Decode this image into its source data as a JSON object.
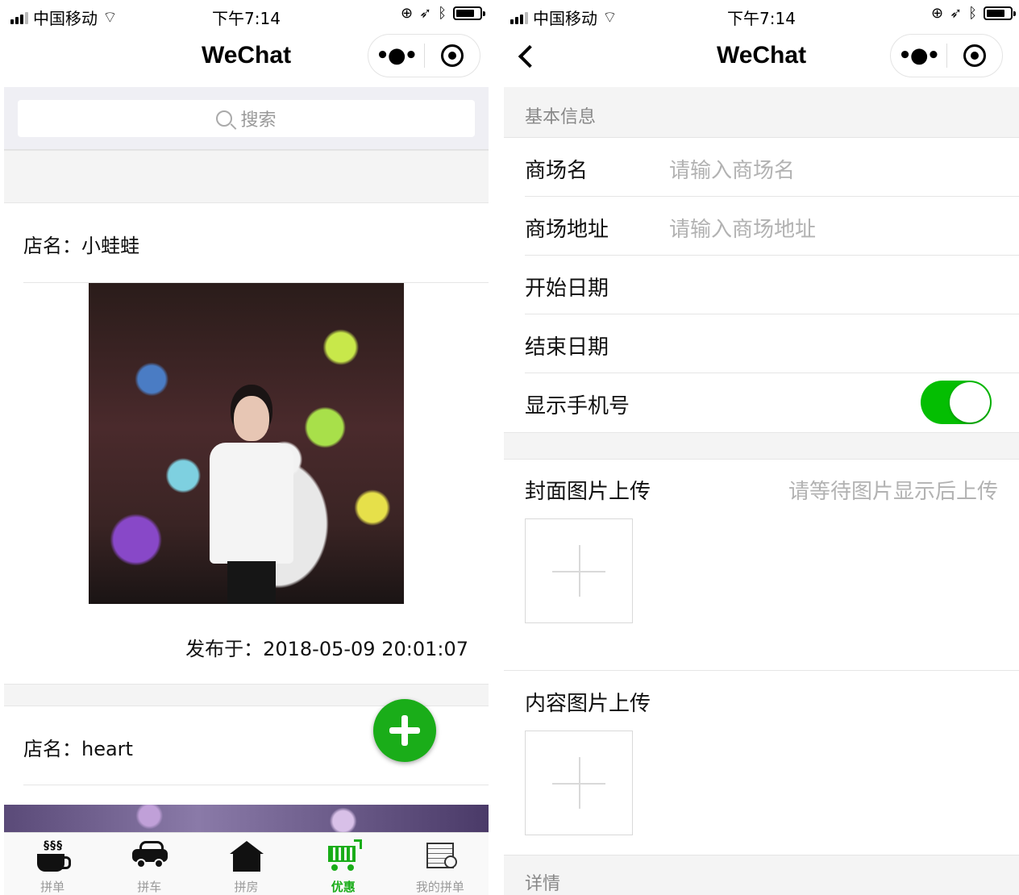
{
  "status": {
    "carrier": "中国移动",
    "time": "下午7:14"
  },
  "left": {
    "nav_title": "WeChat",
    "search_placeholder": "搜索",
    "posts": [
      {
        "store_label": "店名：小蛙蛙",
        "published": "发布于：2018-05-09 20:01:07"
      },
      {
        "store_label": "店名：heart"
      }
    ],
    "tabs": [
      {
        "label": "拼单",
        "icon": "coffee-cup-icon",
        "active": false
      },
      {
        "label": "拼车",
        "icon": "car-icon",
        "active": false
      },
      {
        "label": "拼房",
        "icon": "house-icon",
        "active": false
      },
      {
        "label": "优惠",
        "icon": "shopping-cart-icon",
        "active": true
      },
      {
        "label": "我的拼单",
        "icon": "document-check-icon",
        "active": false
      }
    ]
  },
  "right": {
    "nav_title": "WeChat",
    "section_basic": "基本信息",
    "fields": [
      {
        "label": "商场名",
        "placeholder": "请输入商场名"
      },
      {
        "label": "商场地址",
        "placeholder": "请输入商场地址"
      },
      {
        "label": "开始日期",
        "placeholder": ""
      },
      {
        "label": "结束日期",
        "placeholder": ""
      }
    ],
    "show_phone_label": "显示手机号",
    "show_phone_on": true,
    "cover_upload_label": "封面图片上传",
    "cover_upload_hint": "请等待图片显示后上传",
    "content_upload_label": "内容图片上传",
    "section_detail": "详情"
  },
  "colors": {
    "accent_green": "#1aad19",
    "switch_green": "#04be02",
    "placeholder_gray": "#b2b2b2"
  }
}
